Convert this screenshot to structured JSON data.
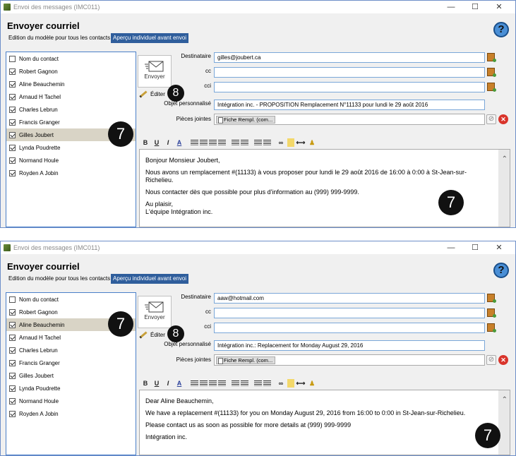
{
  "windows": [
    {
      "title": "Envoi des messages (IMC011)",
      "heading": "Envoyer courriel",
      "tab_inactive": "Edition du modèle pour tous les contacts",
      "tab_active": "Aperçu individuel avant envoi",
      "contacts": [
        {
          "name": "Nom du contact",
          "checked": false,
          "header": true
        },
        {
          "name": "Robert Gagnon",
          "checked": true
        },
        {
          "name": "Aline Beauchemin",
          "checked": true
        },
        {
          "name": "Arnaud H Tachel",
          "checked": true
        },
        {
          "name": "Charles Lebrun",
          "checked": true
        },
        {
          "name": "Francis Granger",
          "checked": true
        },
        {
          "name": "Gilles Joubert",
          "checked": true,
          "selected": true
        },
        {
          "name": "Lynda Poudrette",
          "checked": true
        },
        {
          "name": "Normand Houle",
          "checked": true
        },
        {
          "name": "Royden A Jobin",
          "checked": true
        }
      ],
      "envoyer_label": "Envoyer",
      "editer_label": "Éditer",
      "labels": {
        "to": "Destinataire",
        "cc": "cc",
        "bcc": "cci",
        "subject": "Objet personnalisé",
        "attachments": "Pièces jointes"
      },
      "to": "gilles@joubert.ca",
      "cc": "",
      "bcc": "",
      "subject": "Intégration inc. - PROPOSITION Remplacement N°11133 pour lundi le 29 août 2016",
      "attachment": "Fiche Rempl. (com...",
      "body": [
        "Bonjour Monsieur Joubert,",
        "Nous avons un remplacement #(11133) à vous proposer pour lundi le  29 août 2016 de 16:00 à 0:00 à St-Jean-sur-Richelieu.",
        "Nous contacter dès que possible pour plus d'information au (999) 999-9999.",
        "Au plaisir,",
        "L'équipe Intégration inc."
      ],
      "badges": {
        "contact": "7",
        "editer": "8",
        "body": "7"
      }
    },
    {
      "title": "Envoi des messages (IMC011)",
      "heading": "Envoyer courriel",
      "tab_inactive": "Edition du modèle pour tous les contacts",
      "tab_active": "Aperçu individuel avant envoi",
      "contacts": [
        {
          "name": "Nom du contact",
          "checked": false,
          "header": true
        },
        {
          "name": "Robert Gagnon",
          "checked": true
        },
        {
          "name": "Aline Beauchemin",
          "checked": true,
          "selected": true
        },
        {
          "name": "Arnaud H Tachel",
          "checked": true
        },
        {
          "name": "Charles Lebrun",
          "checked": true
        },
        {
          "name": "Francis Granger",
          "checked": true
        },
        {
          "name": "Gilles Joubert",
          "checked": true
        },
        {
          "name": "Lynda Poudrette",
          "checked": true
        },
        {
          "name": "Normand Houle",
          "checked": true
        },
        {
          "name": "Royden A Jobin",
          "checked": true
        }
      ],
      "envoyer_label": "Envoyer",
      "editer_label": "Éditer",
      "labels": {
        "to": "Destinataire",
        "cc": "cc",
        "bcc": "cci",
        "subject": "Objet personnalisé",
        "attachments": "Pièces jointes"
      },
      "to": "aaw@hotmail.com",
      "cc": "",
      "bcc": "",
      "subject": "Intégration inc.: Replacement for Monday August 29, 2016",
      "attachment": "Fiche Rempl. (com...",
      "body": [
        "Dear Aline Beauchemin,",
        "We have a replacement #(11133) for you on Monday August 29, 2016 from 16:00 to 0:00 in St-Jean-sur-Richelieu.",
        "Please contact us as soon as possible for more details at (999) 999-9999",
        "Intégration inc."
      ],
      "badges": {
        "contact": "7",
        "editer": "8",
        "body": "7"
      }
    }
  ],
  "window_controls": [
    "—",
    "☐",
    "✕"
  ],
  "toolbar_buttons": [
    "B",
    "U",
    "I",
    "A"
  ]
}
